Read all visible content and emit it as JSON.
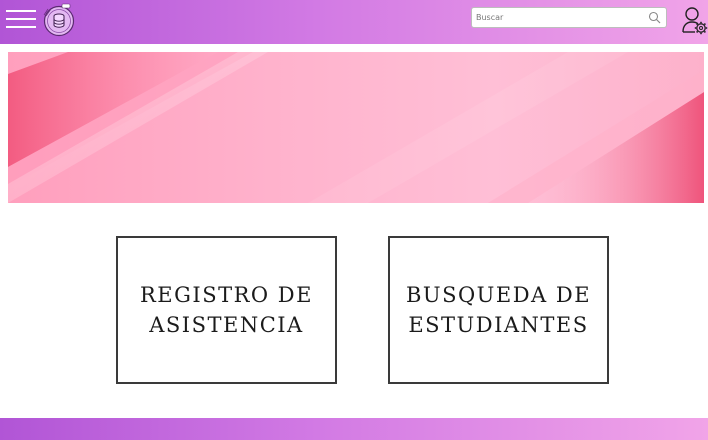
{
  "header": {
    "menu_icon": "hamburger-menu-icon",
    "logo_icon": "database-logo-icon",
    "search": {
      "placeholder": "Buscar",
      "value": "",
      "icon": "search-icon"
    },
    "admin_icon": "user-settings-icon"
  },
  "banner": {
    "image": "pink-diagonal-stripes-banner"
  },
  "cards": [
    {
      "label": "REGISTRO DE\nASISTENCIA"
    },
    {
      "label": "BUSQUEDA DE\nESTUDIANTES"
    }
  ],
  "colors": {
    "header_gradient_start": "#b155d6",
    "header_gradient_end": "#f1a4e8",
    "banner_pink": "#ffb3cd"
  }
}
